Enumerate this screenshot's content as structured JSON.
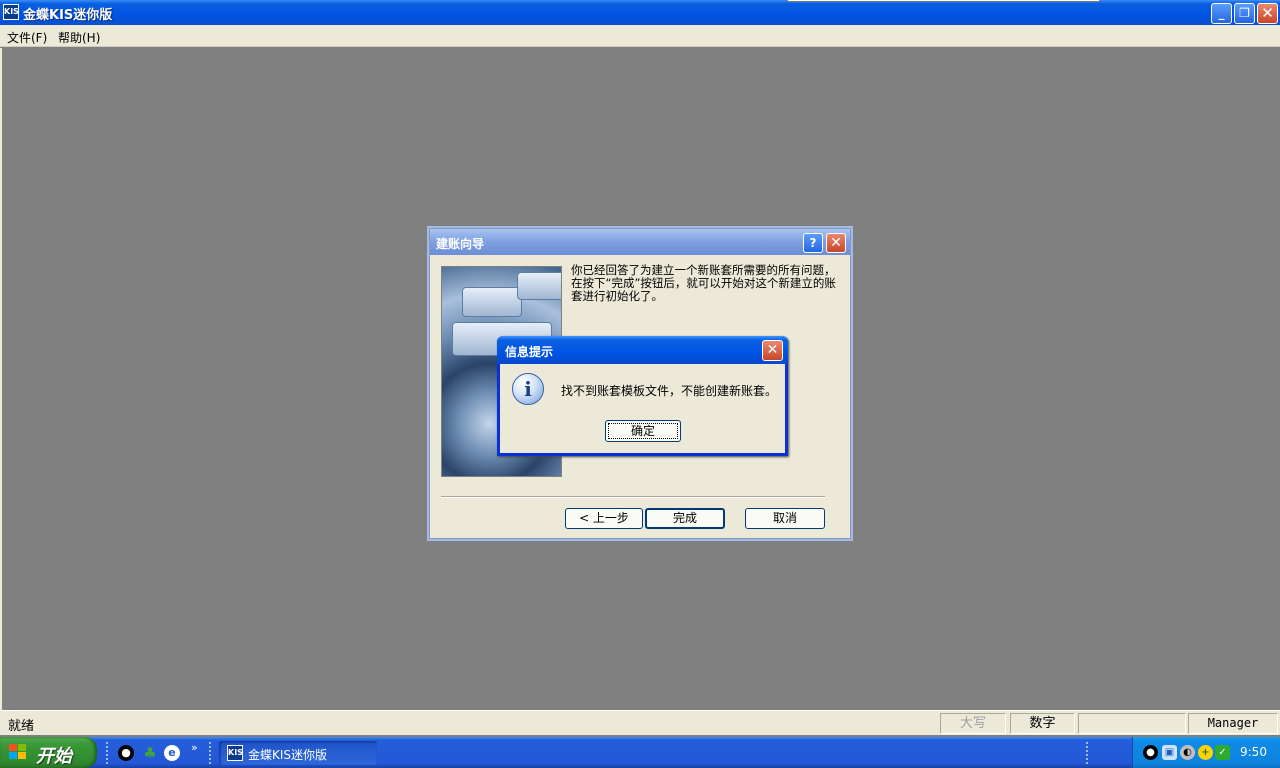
{
  "window": {
    "title": "金蝶KIS迷你版",
    "icon_text": "KIS",
    "minimize_glyph": "_",
    "maximize_glyph": "❐",
    "close_glyph": "✕"
  },
  "menu": {
    "file": "文件(F)",
    "help": "帮助(H)"
  },
  "wizard": {
    "title": "建账向导",
    "help_glyph": "?",
    "close_glyph": "✕",
    "message": "你已经回答了为建立一个新账套所需要的所有问题，在按下“完成”按钮后，就可以开始对这个新建立的账套进行初始化了。",
    "prev_label": "< 上一步",
    "finish_label": "完成",
    "cancel_label": "取消"
  },
  "info_dialog": {
    "title": "信息提示",
    "close_glyph": "✕",
    "icon_glyph": "i",
    "message": "找不到账套模板文件，不能创建新账套。",
    "ok_label": "确定"
  },
  "statusbar": {
    "status": "就绪",
    "caps": "大写",
    "num": "数字",
    "user": "Manager"
  },
  "taskbar": {
    "start_label": "开始",
    "more_glyph": "»",
    "task_label": "金蝶KIS迷你版",
    "task_icon_text": "KIS",
    "clock": "9:50"
  },
  "colors": {
    "titlebar_blue": "#0054e3",
    "desktop_gray": "#808080",
    "dialog_face": "#ece9d8",
    "start_green": "#3c9a3a",
    "close_red": "#c9452a"
  }
}
